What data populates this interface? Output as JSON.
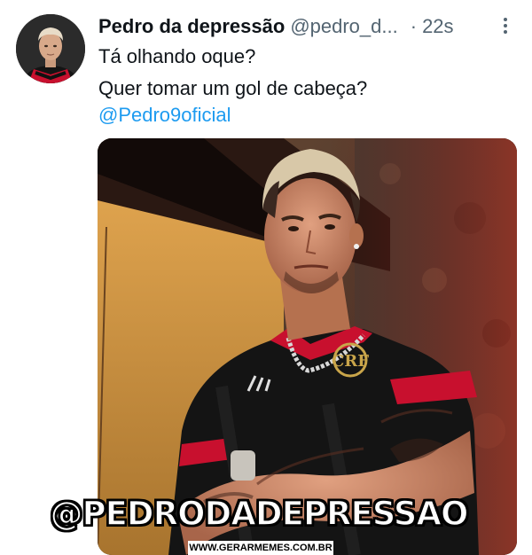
{
  "tweet": {
    "display_name": "Pedro da depressão",
    "handle": "@pedro_d...",
    "separator": "·",
    "time": "22s",
    "text_line_1": "Tá olhando oque?",
    "text_line_2": "Quer tomar um gol de cabeça?",
    "mention": "@Pedro9oficial"
  },
  "icons": {
    "avatar": "profile-photo",
    "more": "vertical-ellipsis-icon"
  },
  "media": {
    "description_icon": "photo-of-player-in-black-red-jersey",
    "jersey_crest": "CRF"
  },
  "meme": {
    "caption": "@PEDRODADEPRESSAO",
    "watermark": "WWW.GERARMEMES.COM.BR"
  },
  "colors": {
    "name": "#0f1419",
    "secondary": "#536471",
    "link": "#1d9bf0",
    "jersey_red": "#c8102e"
  }
}
